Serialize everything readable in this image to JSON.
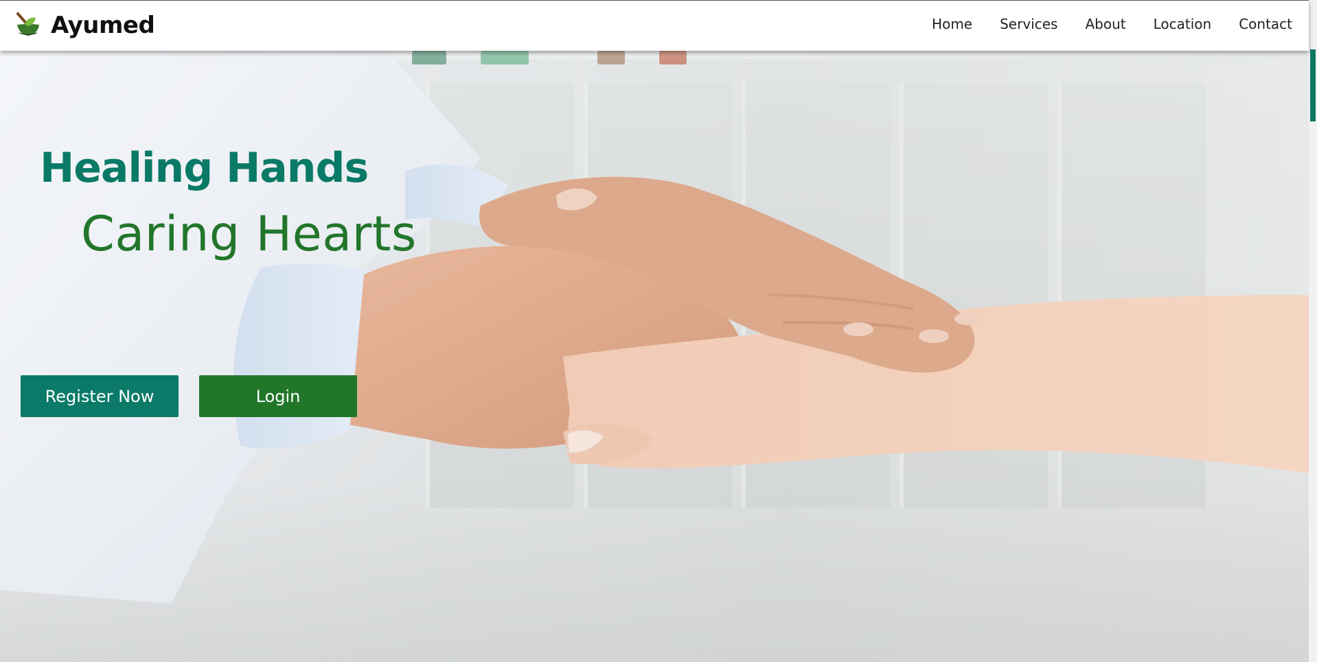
{
  "brand": {
    "name": "Ayumed",
    "logo_icon": "mortar-pestle-leaf-logo"
  },
  "nav": {
    "items": [
      {
        "label": "Home"
      },
      {
        "label": "Services"
      },
      {
        "label": "About"
      },
      {
        "label": "Location"
      },
      {
        "label": "Contact"
      }
    ]
  },
  "hero": {
    "headline": "Healing Hands",
    "subheadline": "Caring Hearts",
    "background_image": "doctor-holding-patient-hand"
  },
  "buttons": {
    "register_label": "Register Now",
    "login_label": "Login"
  },
  "colors": {
    "primary_teal": "#0b7a68",
    "primary_green": "#22762a",
    "headline_teal": "#0a7a66",
    "subheadline_green": "#22762a",
    "navbar_bg": "#ffffff"
  }
}
